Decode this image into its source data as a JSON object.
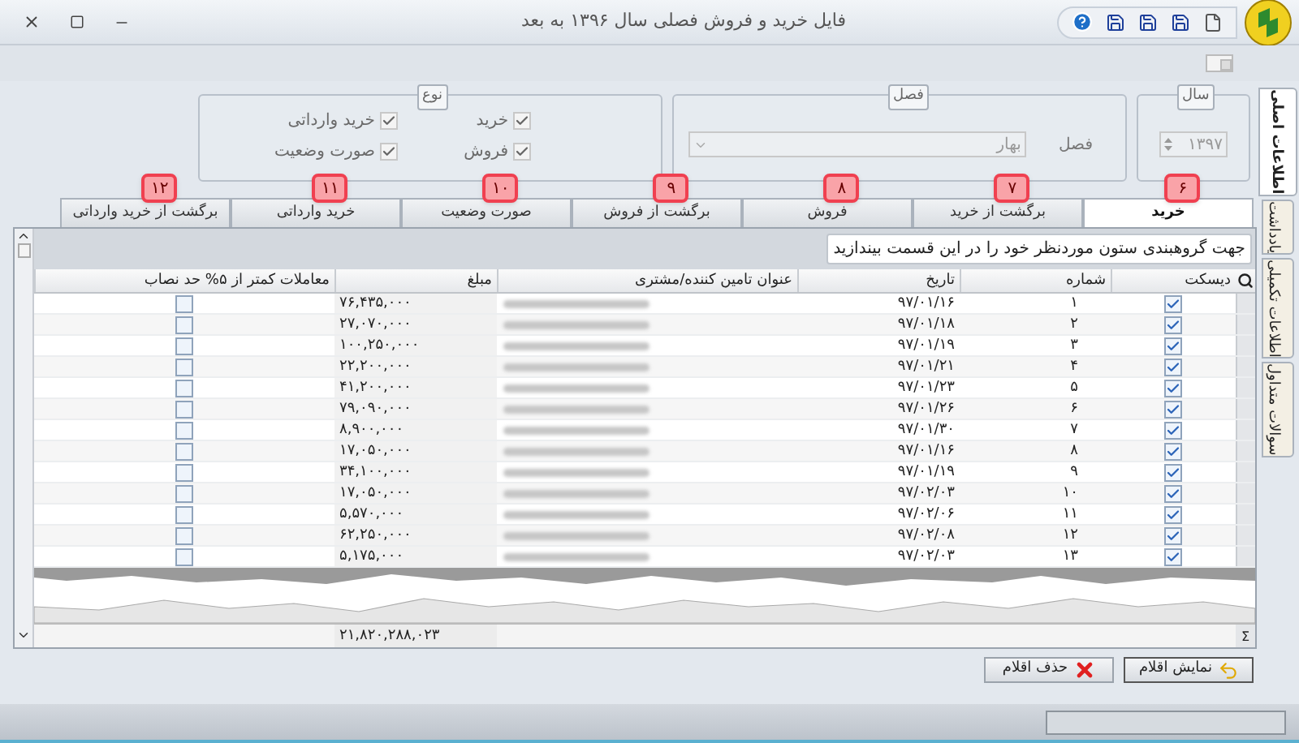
{
  "window": {
    "title": "فایل خرید و فروش فصلی سال ۱۳۹۶ به بعد"
  },
  "side_tabs": [
    {
      "label": "اطلاعات اصلی",
      "selected": true
    },
    {
      "label": "یادداشت",
      "selected": false
    },
    {
      "label": "اطلاعات تکمیلی",
      "selected": false
    },
    {
      "label": "سوالات متداول",
      "selected": false
    }
  ],
  "year_group": {
    "title": "سال",
    "value": "۱۳۹۷"
  },
  "season_group": {
    "title": "فصل",
    "label": "فصل",
    "value": "بهار"
  },
  "type_group": {
    "title": "نوع",
    "options": [
      {
        "label": "خرید",
        "checked": true,
        "disabled": true
      },
      {
        "label": "خرید وارداتی",
        "checked": true,
        "disabled": true
      },
      {
        "label": "فروش",
        "checked": true,
        "disabled": true
      },
      {
        "label": "صورت وضعیت",
        "checked": true,
        "disabled": true
      }
    ]
  },
  "tabs": [
    {
      "label": "خرید",
      "badge": "۶",
      "selected": true
    },
    {
      "label": "برگشت از خرید",
      "badge": "۷",
      "selected": false
    },
    {
      "label": "فروش",
      "badge": "۸",
      "selected": false
    },
    {
      "label": "برگشت از فروش",
      "badge": "۹",
      "selected": false
    },
    {
      "label": "صورت وضعیت",
      "badge": "۱۰",
      "selected": false
    },
    {
      "label": "خرید وارداتی",
      "badge": "۱۱",
      "selected": false
    },
    {
      "label": "برگشت از خرید وارداتی",
      "badge": "۱۲",
      "selected": false
    }
  ],
  "group_by_hint": "جهت گروهبندی ستون موردنظر خود را در این قسمت بیندازید",
  "table": {
    "columns": [
      "دیسکت",
      "شماره",
      "تاریخ",
      "عنوان تامین کننده/مشتری",
      "مبلغ",
      "معاملات کمتر از ۵% حد نصاب"
    ],
    "rows": [
      {
        "disk": true,
        "number": "۱",
        "date": "۹۷/۰۱/۱۶",
        "amount": "۷۶,۴۳۵,۰۰۰",
        "below_threshold": false
      },
      {
        "disk": true,
        "number": "۲",
        "date": "۹۷/۰۱/۱۸",
        "amount": "۲۷,۰۷۰,۰۰۰",
        "below_threshold": false
      },
      {
        "disk": true,
        "number": "۳",
        "date": "۹۷/۰۱/۱۹",
        "amount": "۱۰۰,۲۵۰,۰۰۰",
        "below_threshold": false
      },
      {
        "disk": true,
        "number": "۴",
        "date": "۹۷/۰۱/۲۱",
        "amount": "۲۲,۲۰۰,۰۰۰",
        "below_threshold": false
      },
      {
        "disk": true,
        "number": "۵",
        "date": "۹۷/۰۱/۲۳",
        "amount": "۴۱,۲۰۰,۰۰۰",
        "below_threshold": false
      },
      {
        "disk": true,
        "number": "۶",
        "date": "۹۷/۰۱/۲۶",
        "amount": "۷۹,۰۹۰,۰۰۰",
        "below_threshold": false
      },
      {
        "disk": true,
        "number": "۷",
        "date": "۹۷/۰۱/۳۰",
        "amount": "۸,۹۰۰,۰۰۰",
        "below_threshold": false
      },
      {
        "disk": true,
        "number": "۸",
        "date": "۹۷/۰۱/۱۶",
        "amount": "۱۷,۰۵۰,۰۰۰",
        "below_threshold": false
      },
      {
        "disk": true,
        "number": "۹",
        "date": "۹۷/۰۱/۱۹",
        "amount": "۳۴,۱۰۰,۰۰۰",
        "below_threshold": false
      },
      {
        "disk": true,
        "number": "۱۰",
        "date": "۹۷/۰۲/۰۳",
        "amount": "۱۷,۰۵۰,۰۰۰",
        "below_threshold": false
      },
      {
        "disk": true,
        "number": "۱۱",
        "date": "۹۷/۰۲/۰۶",
        "amount": "۵,۵۷۰,۰۰۰",
        "below_threshold": false
      },
      {
        "disk": true,
        "number": "۱۲",
        "date": "۹۷/۰۲/۰۸",
        "amount": "۶۲,۲۵۰,۰۰۰",
        "below_threshold": false
      },
      {
        "disk": true,
        "number": "۱۳",
        "date": "۹۷/۰۲/۰۳",
        "amount": "۵,۱۷۵,۰۰۰",
        "below_threshold": false
      }
    ],
    "sum_sign": "Σ",
    "total": "۲۱,۸۲۰,۲۸۸,۰۲۳"
  },
  "buttons": [
    {
      "label": "نمایش اقلام",
      "kind": "show"
    },
    {
      "label": "حذف اقلام",
      "kind": "delete"
    }
  ]
}
